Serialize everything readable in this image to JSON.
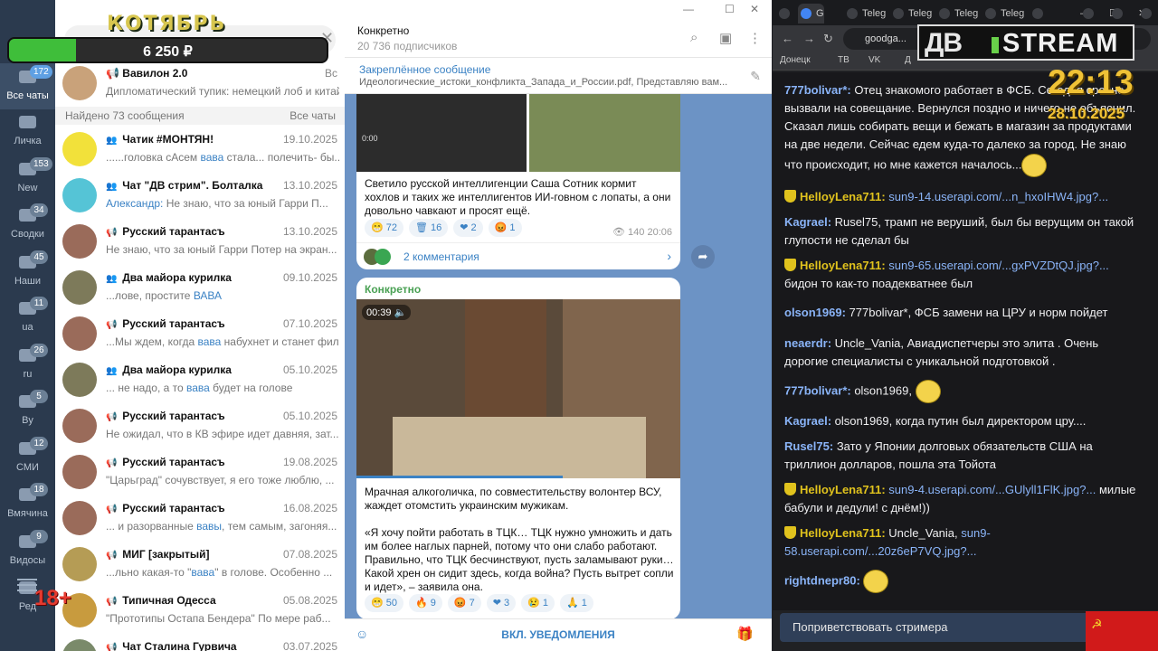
{
  "overlay": {
    "title": "КОТЯБРЬ",
    "donation": "6 250 ₽",
    "donation_fraction": 0.21,
    "age": "18+",
    "stream_logo_left": "ДВ",
    "stream_logo_right": "STREAM",
    "clock": "22:13",
    "date": "28.10.2025"
  },
  "folders": [
    {
      "label": "Все чаты",
      "count": "172",
      "active": true
    },
    {
      "label": "Личка",
      "count": ""
    },
    {
      "label": "New",
      "count": "153"
    },
    {
      "label": "Сводки",
      "count": "34"
    },
    {
      "label": "Наши",
      "count": "45"
    },
    {
      "label": "ua",
      "count": "11"
    },
    {
      "label": "ru",
      "count": "26"
    },
    {
      "label": "By",
      "count": "5"
    },
    {
      "label": "СМИ",
      "count": "12"
    },
    {
      "label": "Вмячина",
      "count": "18"
    },
    {
      "label": "Видосы",
      "count": "9"
    },
    {
      "label": "Ред",
      "count": ""
    }
  ],
  "chatlist": {
    "top_chat": {
      "name": "Вавилон 2.0",
      "date": "Вс",
      "preview": "Дипломатический тупик: немецкий лоб и китай..."
    },
    "found_text": "Найдено 73 сообщения",
    "all_chats": "Все чаты",
    "rows": [
      {
        "name": "Чатик #МОНТЯН!",
        "date": "19.10.2025",
        "pre": "......головка сАсем ",
        "hl": "вава",
        "post": " стала... полечить- бы... ..."
      },
      {
        "name": "Чат \"ДВ стрим\". Болталка",
        "date": "13.10.2025",
        "sender": "Александр:",
        "pre": " ",
        "hl": "",
        "post": "Не знаю, что за юный Гарри П..."
      },
      {
        "name": "Русский тарантасъ",
        "date": "13.10.2025",
        "pre": "Не знаю, что за юный Гарри Потер на экран...",
        "hl": "",
        "post": ""
      },
      {
        "name": "Два майора курилка",
        "date": "09.10.2025",
        "pre": "...лове, простите ",
        "hl": "ВАВА",
        "post": ""
      },
      {
        "name": "Русский тарантасъ",
        "date": "07.10.2025",
        "pre": "...Мы ждем, когда ",
        "hl": "вава",
        "post": " набухнет и станет филе..."
      },
      {
        "name": "Два майора курилка",
        "date": "05.10.2025",
        "pre": "... не надо, а то ",
        "hl": "вава",
        "post": "  будет на голове"
      },
      {
        "name": "Русский тарантасъ",
        "date": "05.10.2025",
        "pre": "Не ожидал, что в КВ эфире идет давняя, зат...",
        "hl": "",
        "post": ""
      },
      {
        "name": "Русский тарантасъ",
        "date": "19.08.2025",
        "pre": "\"Царьград\" сочувствует, я его тоже люблю, ...",
        "hl": "",
        "post": ""
      },
      {
        "name": "Русский тарантасъ",
        "date": "16.08.2025",
        "pre": "... и разорванные ",
        "hl": "вавы",
        "post": ", тем самым, загоняя..."
      },
      {
        "name": "МИГ [закрытый]",
        "date": "07.08.2025",
        "pre": "...льно какая-то \"",
        "hl": "вава",
        "post": "\" в голове.  Особенно ..."
      },
      {
        "name": "Типичная Одесса",
        "date": "05.08.2025",
        "pre": "\"Прототипы Остапа Бендера\"  По мере раб...",
        "hl": "",
        "post": ""
      },
      {
        "name": "Чат Сталина Гурвича",
        "date": "03.07.2025",
        "pre": "",
        "hl": "",
        "post": ""
      }
    ]
  },
  "channel": {
    "title": "Конкретно",
    "subscribers": "20 736 подписчиков",
    "pinned_title": "Закреплённое сообщение",
    "pinned_preview": "Идеологические_истоки_конфликта_Запада_и_России.pdf, Представляю вам...",
    "post1": {
      "thumb_time": "0:00",
      "text": "Светило русской интеллигенции Саша Сотник кормит хохлов и таких же интеллигентов ИИ-говном с лопаты, а они довольно чавкают и просят ещё.",
      "reactions": [
        "😁 72",
        "🗑 16",
        "❤ 2",
        "😡 1"
      ],
      "views": "👁 140  20:06",
      "comments": "2 комментария"
    },
    "post2": {
      "name": "Конкретно",
      "video_time": "00:39",
      "text1": "Мрачная алкоголичка, по совместительству волонтер ВСУ, жаждет отомстить украинским мужикам.",
      "text2": "«Я хочу пойти работать в ТЦК… ТЦК нужно умножить и дать им более наглых парней, потому что они слабо работают. Правильно, что ТЦК бесчинствуют, пусть заламывают руки… Какой хрен он сидит здесь, когда война? Пусть вытрет сопли и идет», – заявила она.",
      "reactions": [
        "😁 50",
        "🔥 9",
        "😡 7",
        "❤ 3",
        "😢 1",
        "🙏 1"
      ]
    },
    "notifications": "ВКЛ. УВЕДОМЛЕНИЯ"
  },
  "browser": {
    "tabs": [
      "G",
      "Teleg",
      "Teleg",
      "Teleg",
      "Teleg"
    ],
    "url": "goodga...",
    "bookmarks": [
      "Донецк",
      "ТВ",
      "VK",
      "Д"
    ],
    "chat": [
      {
        "user": "777bolivar*:",
        "color": "#8ab4f8",
        "text": " Отец знакомого работает в ФСБ. Сегодня срочно вызвали на совещание. Вернулся поздно и ничего не объяснил. Сказал лишь собирать вещи и бежать в магазин за продуктами на две недели. Сейчас едем куда-то далеко за город. Не знаю что происходит, но мне кажется началось...",
        "emote": true
      },
      {
        "user": "HelloyLena711:",
        "color": "#e0c21d",
        "badge": true,
        "link": "sun9-14.userapi.com/...n_hxoIHW4.jpg?...",
        "text": ""
      },
      {
        "user": "Kagrael:",
        "color": "#8ab4f8",
        "text": " Rusel75, трамп не веруший, был бы верущим он такой глупости не сделал бы"
      },
      {
        "user": "HelloyLena711:",
        "color": "#e0c21d",
        "badge": true,
        "link": "sun9-65.userapi.com/...gxPVZDtQJ.jpg?...",
        "text": " бидон то как-то поадекватнее был"
      },
      {
        "user": "olson1969:",
        "color": "#8ab4f8",
        "text": " 777bolivar*, ФСБ замени на ЦРУ и норм пойдет"
      },
      {
        "user": "neaerdr:",
        "color": "#8ab4f8",
        "text": " Uncle_Vania, Авиадиспетчеры это элита . Очень дорогие специалисты с уникальной подготовкой ."
      },
      {
        "user": "777bolivar*:",
        "color": "#8ab4f8",
        "text": " olson1969, ",
        "emote": true
      },
      {
        "user": "Kagrael:",
        "color": "#8ab4f8",
        "text": " olson1969, когда путин был директором цру...."
      },
      {
        "user": "Rusel75:",
        "color": "#8ab4f8",
        "text": " Зато у Японии долговых обязательств США на триллион долларов, пошла эта Тойота"
      },
      {
        "user": "HelloyLena711:",
        "color": "#e0c21d",
        "badge": true,
        "link": "sun9-4.userapi.com/...GUlyll1FlK.jpg?...",
        "text": " милые бабули и дедули! с днём!))"
      },
      {
        "user": "HelloyLena711:",
        "color": "#e0c21d",
        "badge": true,
        "text": " Uncle_Vania, ",
        "link2": "sun9-58.userapi.com/...20z6eP7VQ.jpg?..."
      },
      {
        "user": "rightdnepr80:",
        "color": "#8ab4f8",
        "text": " ",
        "emote": true
      }
    ],
    "greet": "Поприветствовать стримера",
    "flag_symbol": "☭"
  }
}
